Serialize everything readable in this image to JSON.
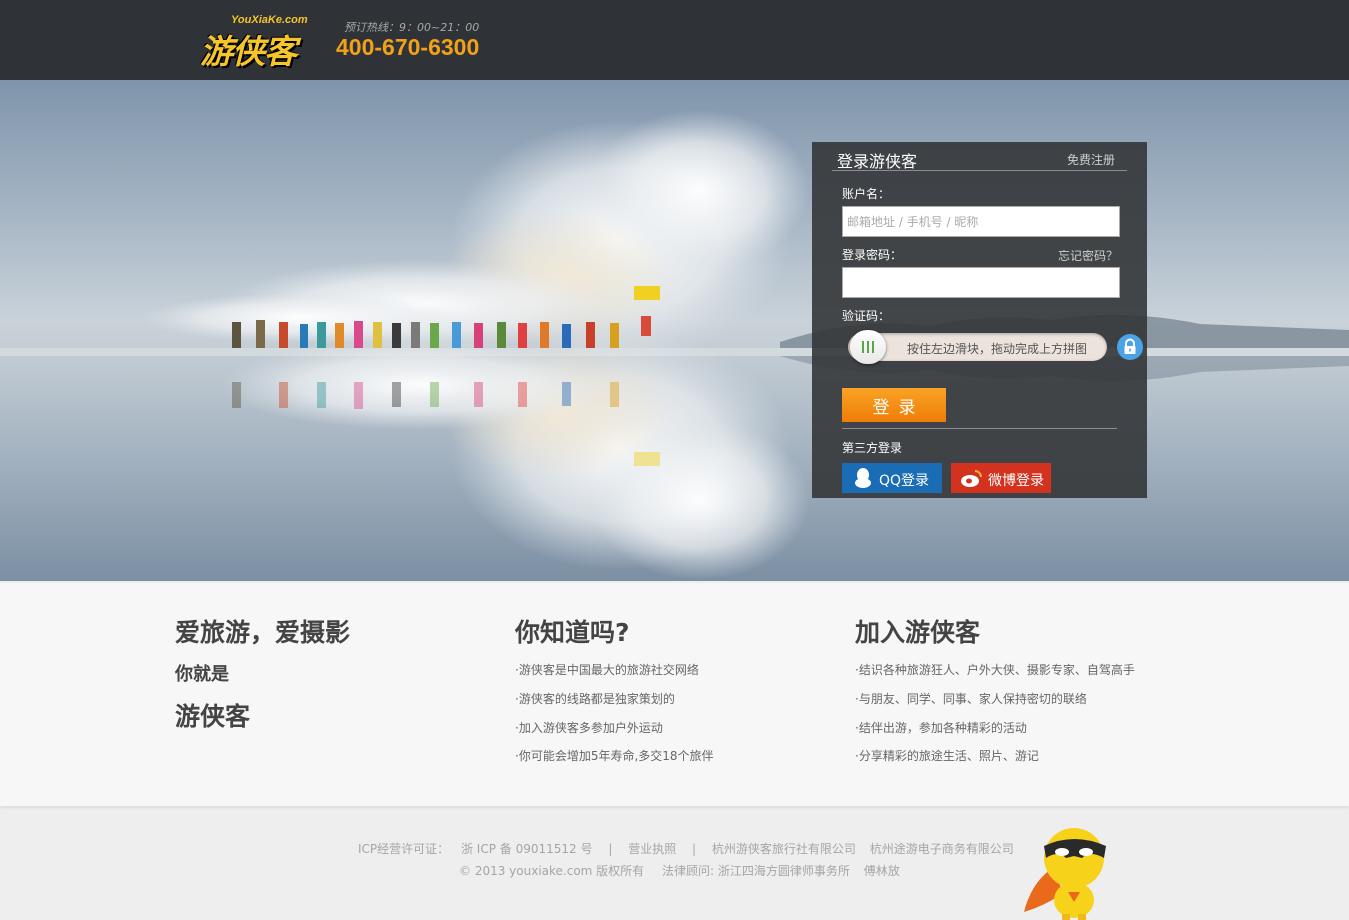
{
  "header": {
    "logo_small": "YouXiaKe.com",
    "logo_main": "游侠客",
    "hotline_label": "预订热线：9：00~21：00",
    "hotline_number": "400-670-6300",
    "accent_color": "#f2a11a"
  },
  "login": {
    "title": "登录游侠客",
    "register_link": "免费注册",
    "account_label": "账户名：",
    "account_placeholder": "邮箱地址 / 手机号 / 昵称",
    "password_label": "登录密码：",
    "forgot_link": "忘记密码？",
    "password_value": "",
    "captcha_label": "验证码：",
    "slider_hint": "按住左边滑块，拖动完成上方拼图",
    "submit_label": "登录",
    "third_party_label": "第三方登录",
    "qq_label": "QQ登录",
    "weibo_label": "微博登录",
    "icons": [
      "lock-icon",
      "qq-penguin-icon",
      "weibo-icon",
      "slider-grip-icon"
    ]
  },
  "info": {
    "col1": {
      "line1": "爱旅游，爱摄影",
      "line2": "你就是",
      "line3": "游侠客"
    },
    "col2": {
      "title": "你知道吗?",
      "items": [
        "·游侠客是中国最大的旅游社交网络",
        "·游侠客的线路都是独家策划的",
        "·加入游侠客多参加户外运动",
        "·你可能会增加5年寿命,多交18个旅伴"
      ]
    },
    "col3": {
      "title": "加入游侠客",
      "items": [
        "·结识各种旅游狂人、户外大侠、摄影专家、自驾高手",
        "·与朋友、同学、同事、家人保持密切的联络",
        "·结伴出游，参加各种精彩的活动",
        "·分享精彩的旅途生活、照片、游记"
      ]
    }
  },
  "footer": {
    "icp_label": "ICP经营许可证：",
    "icp_number": "浙 ICP 备 09011512 号",
    "sep": "|",
    "license": "营业执照",
    "company1": "杭州游侠客旅行社有限公司",
    "company2": "杭州途游电子商务有限公司",
    "copyright": "© 2013 youxiake.com 版权所有",
    "legal_label": "法律顾问:",
    "legal_firm": "浙江四海方圆律师事务所",
    "legal_person": "傅林放"
  }
}
